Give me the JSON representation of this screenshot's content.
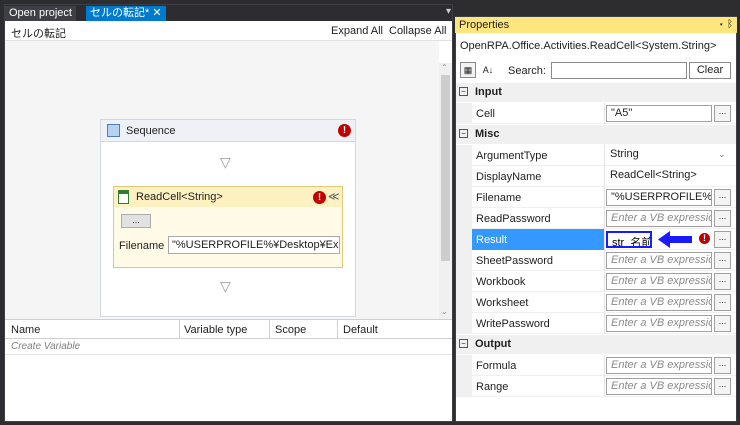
{
  "tabs": {
    "open_project": "Open project",
    "active": "セルの転記*",
    "active_close": "✕",
    "menu_glyph": "▾"
  },
  "designer": {
    "title": "セルの転記",
    "expand_all": "Expand All",
    "collapse_all": "Collapse All"
  },
  "sequence": {
    "label": "Sequence",
    "error_glyph": "!"
  },
  "readcell": {
    "label": "ReadCell<String>",
    "error_glyph": "!",
    "collapse_glyph": "≪",
    "button_label": "...",
    "filename_label": "Filename",
    "filename_value": "\"%USERPROFILE%¥Desktop¥Exc"
  },
  "variables": {
    "columns": [
      "Name",
      "Variable type",
      "Scope",
      "Default"
    ],
    "create_hint": "Create Variable"
  },
  "properties": {
    "tab_title": "Properties",
    "tab_controls": "▾ ᛒ",
    "type_name": "OpenRPA.Office.Activities.ReadCell<System.String>",
    "search_label": "Search:",
    "search_value": "",
    "clear_label": "Clear",
    "sort_glyph": "A↓",
    "categories": {
      "input": "Input",
      "misc": "Misc",
      "output": "Output"
    },
    "rows": {
      "cell": {
        "name": "Cell",
        "value": "\"A5\""
      },
      "argument_type": {
        "name": "ArgumentType",
        "value": "String"
      },
      "display_name": {
        "name": "DisplayName",
        "value": "ReadCell<String>"
      },
      "filename": {
        "name": "Filename",
        "value": "\"%USERPROFILE%¥[",
        "dots": "..."
      },
      "read_password": {
        "name": "ReadPassword",
        "value": "Enter a VB expressio"
      },
      "result": {
        "name": "Result",
        "value": "str_名前"
      },
      "sheet_password": {
        "name": "SheetPassword",
        "value": "Enter a VB expressio"
      },
      "workbook": {
        "name": "Workbook",
        "value": "Enter a VB expressio"
      },
      "worksheet": {
        "name": "Worksheet",
        "value": "Enter a VB expressio"
      },
      "write_password": {
        "name": "WritePassword",
        "value": "Enter a VB expressio"
      },
      "formula": {
        "name": "Formula",
        "value": "Enter a VB expressio"
      },
      "range": {
        "name": "Range",
        "value": "Enter a VB expressio"
      }
    },
    "ellipsis": "...",
    "error_glyph": "!"
  },
  "colors": {
    "accent_tab": "#007acc",
    "properties_tab": "#ffe57d",
    "selection": "#3399ff",
    "error": "#c00000",
    "arrow": "#1a1aff"
  }
}
